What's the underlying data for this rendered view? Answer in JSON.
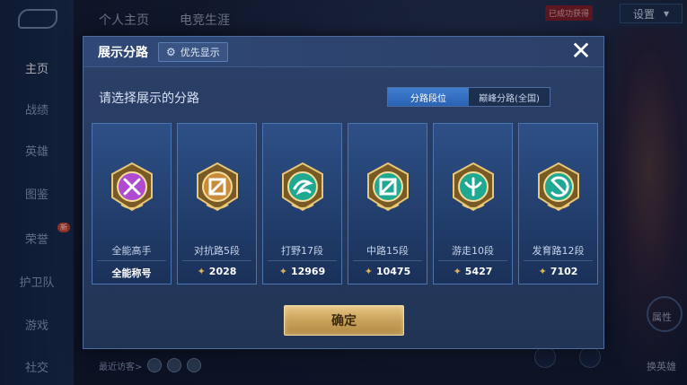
{
  "sidebar": {
    "items": [
      {
        "label": "主页",
        "active": true
      },
      {
        "label": "战绩"
      },
      {
        "label": "英雄"
      },
      {
        "label": "图鉴"
      },
      {
        "label": "荣誉",
        "badge": "新"
      },
      {
        "label": "护卫队"
      },
      {
        "label": "游戏"
      },
      {
        "label": "社交"
      }
    ]
  },
  "header": {
    "tabs": [
      "个人主页",
      "电竞生涯"
    ],
    "settings_label": "设置",
    "notice_text": "已成功获得"
  },
  "background": {
    "visitors_label": "最近访客>",
    "right_labels": [
      "属性",
      "换英雄"
    ]
  },
  "modal": {
    "title": "展示分路",
    "pref_label": "优先显示",
    "close_glyph": "✕",
    "subtitle": "请选择展示的分路",
    "toggle": [
      "分路段位",
      "巅峰分路(全国)"
    ],
    "toggle_active": 0,
    "cards": [
      {
        "name": "全能高手",
        "score": "全能称号",
        "badge_color": "#b04ad0",
        "show_points_icon": false
      },
      {
        "name": "对抗路5段",
        "score": "2028",
        "badge_color": "#c98a3a",
        "show_points_icon": true
      },
      {
        "name": "打野17段",
        "score": "12969",
        "badge_color": "#1fa892",
        "show_points_icon": true
      },
      {
        "name": "中路15段",
        "score": "10475",
        "badge_color": "#1fa892",
        "show_points_icon": true
      },
      {
        "name": "游走10段",
        "score": "5427",
        "badge_color": "#1fa892",
        "show_points_icon": true
      },
      {
        "name": "发育路12段",
        "score": "7102",
        "badge_color": "#1fa892",
        "show_points_icon": true
      }
    ],
    "confirm_label": "确定"
  },
  "colors": {
    "accent_blue": "#2a62b4",
    "gold": "#c9a25a",
    "modal_bg": "#263a5f"
  }
}
